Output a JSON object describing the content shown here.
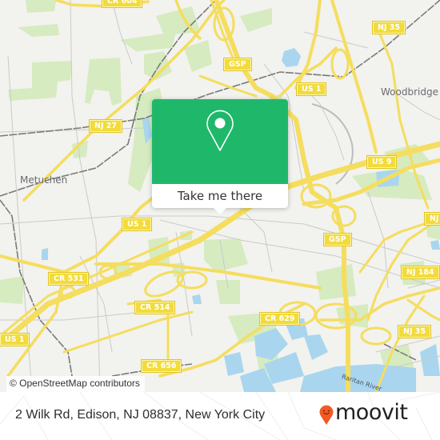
{
  "map": {
    "colors": {
      "land": "#f2f2ee",
      "park": "#d6ebc0",
      "water": "#a9d6ee",
      "highway": "#f5dd5e",
      "minor_road": "#c9c9c9",
      "railway": "#777777",
      "popup_green": "#1fb86b",
      "moovit_orange": "#f15a24"
    },
    "places": [
      {
        "name": "Metuchen"
      },
      {
        "name": "Woodbridge"
      }
    ],
    "river_label": "Raritan River",
    "shields": [
      {
        "label": "CR 604"
      },
      {
        "label": "NJ 35"
      },
      {
        "label": "GSP"
      },
      {
        "label": "US 1"
      },
      {
        "label": "NJ 27"
      },
      {
        "label": "US 9"
      },
      {
        "label": "US 1"
      },
      {
        "label": "GSP"
      },
      {
        "label": "NJ"
      },
      {
        "label": "CR 531"
      },
      {
        "label": "NJ 184"
      },
      {
        "label": "CR 514"
      },
      {
        "label": "CR 629"
      },
      {
        "label": "NJ 35"
      },
      {
        "label": "US 1"
      },
      {
        "label": "CR 656"
      }
    ],
    "attribution": "© OpenStreetMap contributors"
  },
  "popup": {
    "icon": "location-pin-icon",
    "button_label": "Take me there"
  },
  "footer": {
    "address": "2 Wilk Rd, Edison, NJ 08837, New York City",
    "logo_text": "moovit",
    "logo_icon": "moovit-smiley-pin-icon"
  }
}
